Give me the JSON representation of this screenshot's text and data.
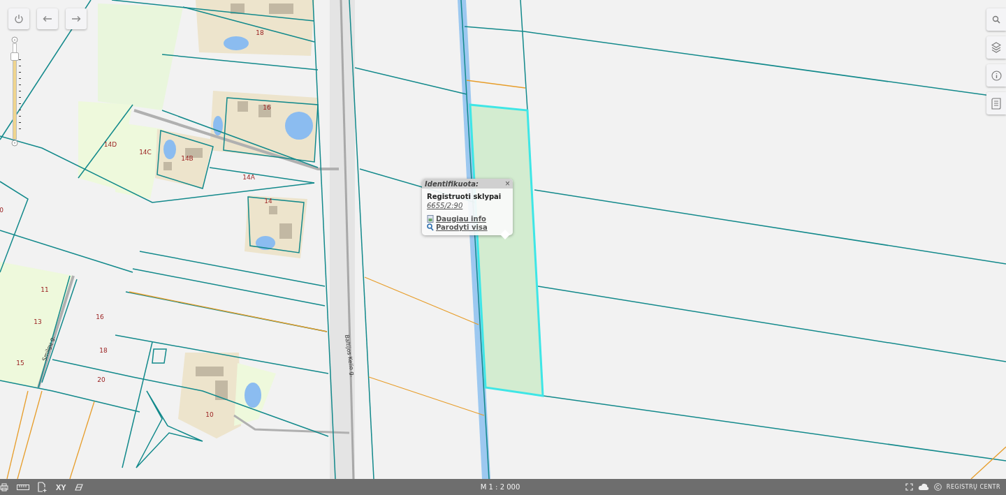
{
  "map": {
    "parcel_labels": [
      "18",
      "16",
      "14D",
      "14C",
      "14B",
      "14A",
      "14",
      "0",
      "11",
      "13",
      "15",
      "16",
      "18",
      "20",
      "10"
    ],
    "street_labels": [
      "Smilgų g.",
      "Baltijos Kelio g."
    ],
    "zoom_slider": {
      "level": 0.87
    }
  },
  "popup": {
    "title": "Identifikuota:",
    "close": "×",
    "heading": "Registruoti sklypai",
    "parcel_id": "6655/2:90",
    "links": [
      {
        "kind": "info",
        "label": "Daugiau info"
      },
      {
        "kind": "zoom",
        "label": "Parodyti visa"
      }
    ]
  },
  "bottom_bar": {
    "xy_label": "XY",
    "scale": "M 1 : 2 000",
    "copyright": "REGISTRŲ CENTR"
  }
}
